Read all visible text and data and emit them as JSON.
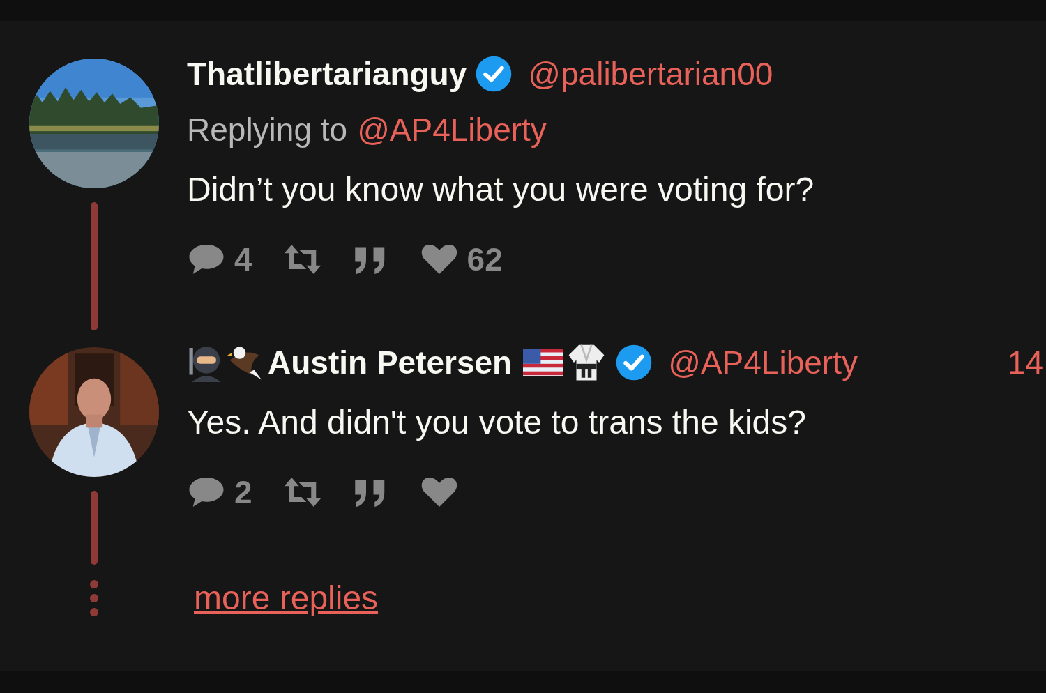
{
  "tweets": [
    {
      "fullname": "Thatlibertarianguy",
      "verified": true,
      "username": "@palibertarian00",
      "replying_to": {
        "label": "Replying to",
        "handle": "@AP4Liberty"
      },
      "text": "Didn’t you know what you were voting for?",
      "stats": [
        {
          "kind": "comment",
          "count": "4"
        },
        {
          "kind": "retweet"
        },
        {
          "kind": "quote"
        },
        {
          "kind": "like",
          "count": "62"
        }
      ]
    },
    {
      "emoji_before": [
        {
          "kind": "ninja"
        },
        {
          "kind": "eagle"
        }
      ],
      "fullname": "Austin Petersen",
      "emoji_after": [
        {
          "kind": "flag"
        },
        {
          "kind": "uniform"
        }
      ],
      "verified": true,
      "username": "@AP4Liberty",
      "date": "14",
      "text": "Yes. And didn't you vote to trans the kids?",
      "stats": [
        {
          "kind": "comment",
          "count": "2"
        },
        {
          "kind": "retweet"
        },
        {
          "kind": "quote"
        },
        {
          "kind": "like"
        }
      ]
    }
  ],
  "more_replies": "more replies"
}
